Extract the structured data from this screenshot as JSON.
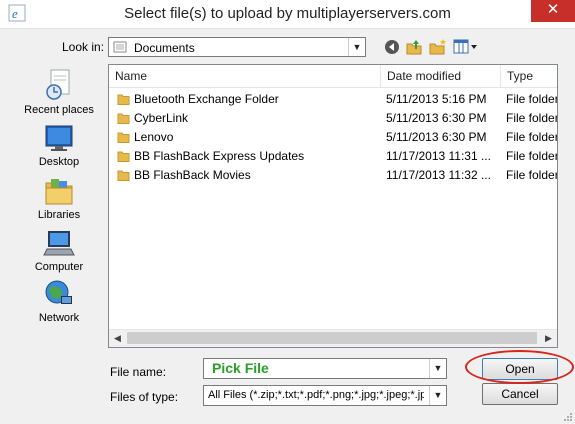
{
  "window": {
    "title": "Select file(s) to upload by multiplayerservers.com",
    "close_glyph": "✕"
  },
  "look_in": {
    "label": "Look in:",
    "value": "Documents"
  },
  "toolbar": {
    "icons": [
      "back-icon",
      "up-folder-icon",
      "new-folder-icon",
      "view-menu-icon"
    ]
  },
  "places": [
    {
      "label": "Recent places",
      "icon": "recent-places-icon"
    },
    {
      "label": "Desktop",
      "icon": "desktop-icon"
    },
    {
      "label": "Libraries",
      "icon": "libraries-icon"
    },
    {
      "label": "Computer",
      "icon": "computer-icon"
    },
    {
      "label": "Network",
      "icon": "network-icon"
    }
  ],
  "file_list": {
    "columns": [
      "Name",
      "Date modified",
      "Type"
    ],
    "rows": [
      {
        "name": "Bluetooth Exchange Folder",
        "date": "5/11/2013 5:16 PM",
        "type": "File folder"
      },
      {
        "name": "CyberLink",
        "date": "5/11/2013 6:30 PM",
        "type": "File folder"
      },
      {
        "name": "Lenovo",
        "date": "5/11/2013 6:30 PM",
        "type": "File folder"
      },
      {
        "name": "BB FlashBack Express Updates",
        "date": "11/17/2013 11:31 ...",
        "type": "File folder"
      },
      {
        "name": "BB FlashBack Movies",
        "date": "11/17/2013 11:32 ...",
        "type": "File folder"
      }
    ]
  },
  "file_name": {
    "label": "File name:",
    "value": "Pick File"
  },
  "file_type": {
    "label": "Files of type:",
    "value": "All Files (*.zip;*.txt;*.pdf;*.png;*.jpg;*.jpeg;*.jpe;*.gif)"
  },
  "buttons": {
    "open": "Open",
    "cancel": "Cancel"
  },
  "colors": {
    "close": "#c7302a",
    "highlight_ring": "#d9251d",
    "file_name_text": "#2aa02a",
    "folder": "#e8b94a"
  }
}
